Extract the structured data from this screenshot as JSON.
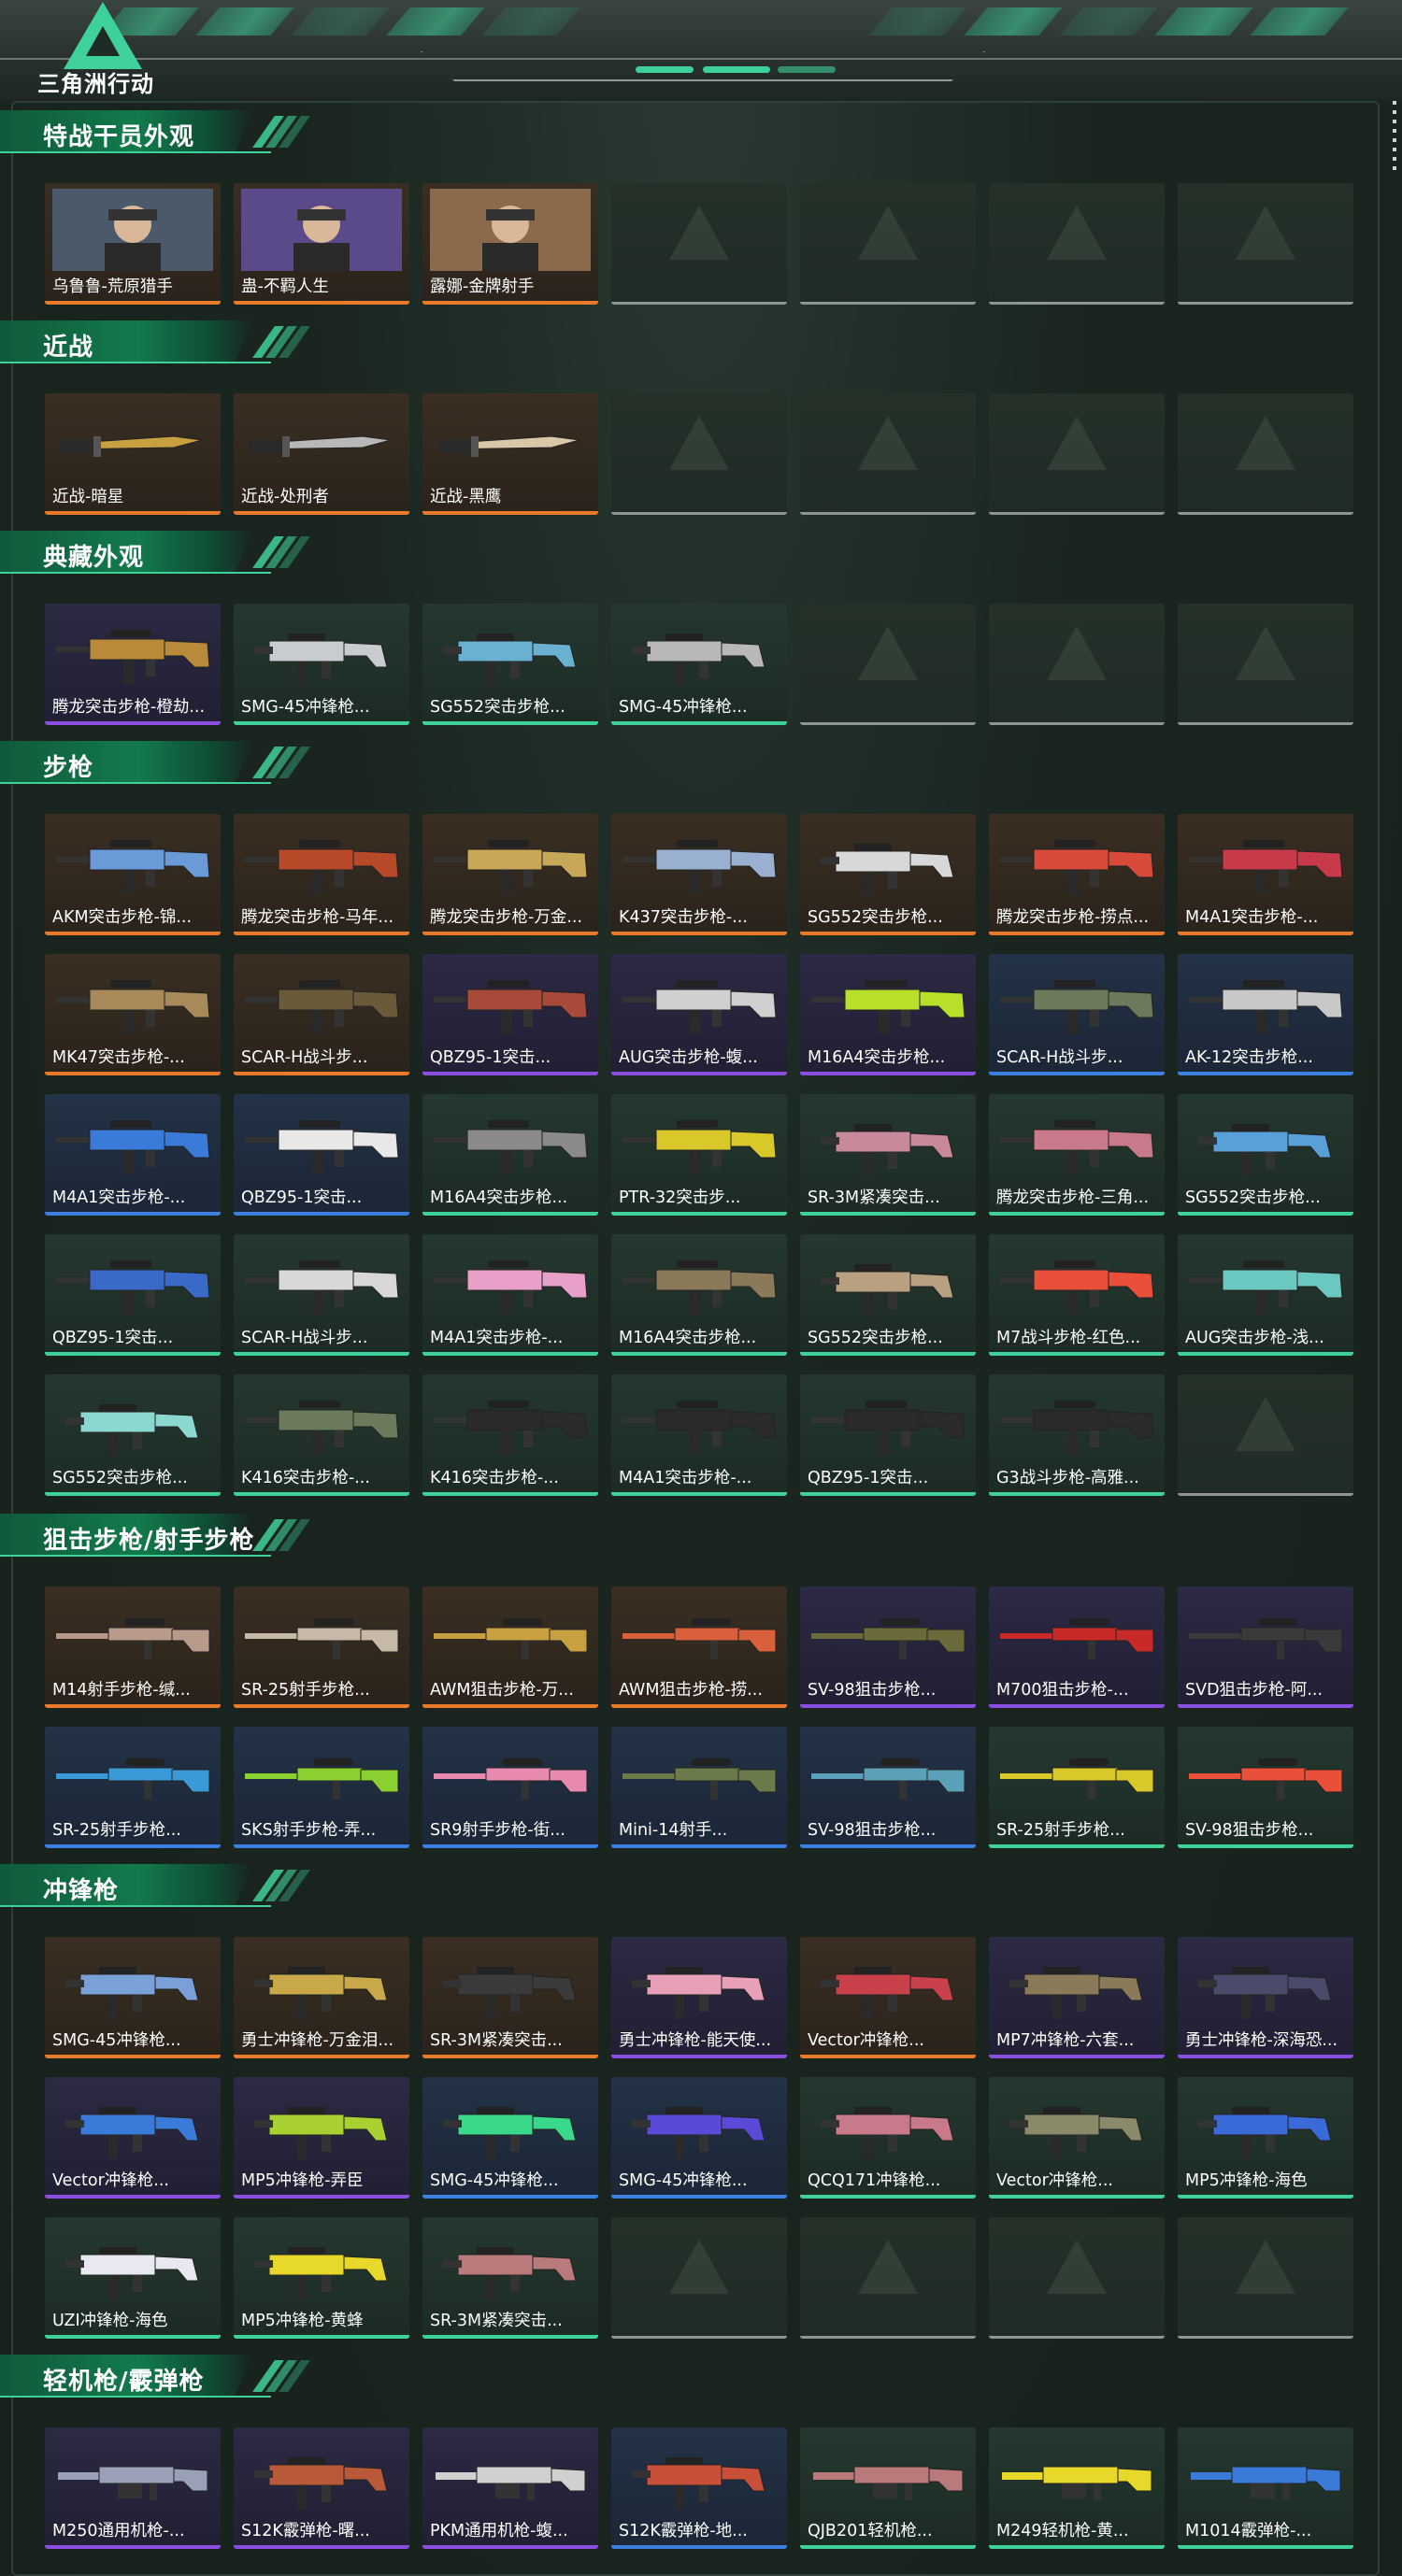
{
  "app": {
    "logo_text": "三角洲行动"
  },
  "sections": [
    {
      "title": "特战干员外观",
      "items": [
        {
          "name": "乌鲁鲁-荒原猎手",
          "rarity": "orange",
          "kind": "operator",
          "color": "#4a5a6a"
        },
        {
          "name": "蛊-不羁人生",
          "rarity": "orange",
          "kind": "operator",
          "color": "#5a4a8a"
        },
        {
          "name": "露娜-金牌射手",
          "rarity": "orange",
          "kind": "operator",
          "color": "#8a6a4a"
        },
        {
          "empty": true
        },
        {
          "empty": true
        },
        {
          "empty": true
        },
        {
          "empty": true
        }
      ]
    },
    {
      "title": "近战",
      "items": [
        {
          "name": "近战-暗星",
          "rarity": "orange",
          "kind": "knife",
          "color": "#c9a040"
        },
        {
          "name": "近战-处刑者",
          "rarity": "orange",
          "kind": "knife",
          "color": "#b8b8b8"
        },
        {
          "name": "近战-黑鹰",
          "rarity": "orange",
          "kind": "knife",
          "color": "#d8c8a8"
        },
        {
          "empty": true
        },
        {
          "empty": true
        },
        {
          "empty": true
        },
        {
          "empty": true
        }
      ]
    },
    {
      "title": "典藏外观",
      "items": [
        {
          "name": "腾龙突击步枪-橙劫...",
          "rarity": "purple",
          "kind": "rifle",
          "color": "#b88a3a"
        },
        {
          "name": "SMG-45冲锋枪...",
          "rarity": "green",
          "kind": "smg",
          "color": "#c8ccd0"
        },
        {
          "name": "SG552突击步枪...",
          "rarity": "green",
          "kind": "smg",
          "color": "#6ab0d0"
        },
        {
          "name": "SMG-45冲锋枪...",
          "rarity": "green",
          "kind": "smg",
          "color": "#b8b8b8"
        },
        {
          "empty": true
        },
        {
          "empty": true
        },
        {
          "empty": true
        }
      ]
    },
    {
      "title": "步枪",
      "items": [
        {
          "name": "AKM突击步枪-锦...",
          "rarity": "orange",
          "kind": "rifle",
          "color": "#6a9ad8"
        },
        {
          "name": "腾龙突击步枪-马年...",
          "rarity": "orange",
          "kind": "rifle",
          "color": "#b84a2a"
        },
        {
          "name": "腾龙突击步枪-万金...",
          "rarity": "orange",
          "kind": "rifle",
          "color": "#c8a858"
        },
        {
          "name": "K437突击步枪-...",
          "rarity": "orange",
          "kind": "rifle",
          "color": "#9ab0d0"
        },
        {
          "name": "SG552突击步枪...",
          "rarity": "orange",
          "kind": "smg",
          "color": "#d8d8d8"
        },
        {
          "name": "腾龙突击步枪-捞点...",
          "rarity": "orange",
          "kind": "rifle",
          "color": "#d84a3a"
        },
        {
          "name": "M4A1突击步枪-...",
          "rarity": "orange",
          "kind": "rifle",
          "color": "#c83a4a"
        },
        {
          "name": "MK47突击步枪-...",
          "rarity": "orange",
          "kind": "rifle",
          "color": "#a88a5a"
        },
        {
          "name": "SCAR-H战斗步...",
          "rarity": "orange",
          "kind": "rifle",
          "color": "#6a5a3a"
        },
        {
          "name": "QBZ95-1突击...",
          "rarity": "purple",
          "kind": "rifle",
          "color": "#a84a3a"
        },
        {
          "name": "AUG突击步枪-蝮...",
          "rarity": "purple",
          "kind": "rifle",
          "color": "#d0d0d0"
        },
        {
          "name": "M16A4突击步枪...",
          "rarity": "purple",
          "kind": "rifle",
          "color": "#b8e02a"
        },
        {
          "name": "SCAR-H战斗步...",
          "rarity": "blue",
          "kind": "rifle",
          "color": "#6a7a5a"
        },
        {
          "name": "AK-12突击步枪...",
          "rarity": "blue",
          "kind": "rifle",
          "color": "#c8c8c8"
        },
        {
          "name": "M4A1突击步枪-...",
          "rarity": "blue",
          "kind": "rifle",
          "color": "#3a7ad8"
        },
        {
          "name": "QBZ95-1突击...",
          "rarity": "blue",
          "kind": "rifle",
          "color": "#e8e8e8"
        },
        {
          "name": "M16A4突击步枪...",
          "rarity": "green",
          "kind": "rifle",
          "color": "#8a8a8a"
        },
        {
          "name": "PTR-32突击步...",
          "rarity": "green",
          "kind": "rifle",
          "color": "#d8c82a"
        },
        {
          "name": "SR-3M紧凑突击...",
          "rarity": "green",
          "kind": "smg",
          "color": "#c88a9a"
        },
        {
          "name": "腾龙突击步枪-三角...",
          "rarity": "green",
          "kind": "rifle",
          "color": "#c87a8a"
        },
        {
          "name": "SG552突击步枪...",
          "rarity": "green",
          "kind": "smg",
          "color": "#5aa0d8"
        },
        {
          "name": "QBZ95-1突击...",
          "rarity": "green",
          "kind": "rifle",
          "color": "#3a6ac8"
        },
        {
          "name": "SCAR-H战斗步...",
          "rarity": "green",
          "kind": "rifle",
          "color": "#d8d8d8"
        },
        {
          "name": "M4A1突击步枪-...",
          "rarity": "green",
          "kind": "rifle",
          "color": "#e8a0c8"
        },
        {
          "name": "M16A4突击步枪...",
          "rarity": "green",
          "kind": "rifle",
          "color": "#8a7a5a"
        },
        {
          "name": "SG552突击步枪...",
          "rarity": "green",
          "kind": "smg",
          "color": "#b8a080"
        },
        {
          "name": "M7战斗步枪-红色...",
          "rarity": "green",
          "kind": "rifle",
          "color": "#e8503a"
        },
        {
          "name": "AUG突击步枪-浅...",
          "rarity": "green",
          "kind": "rifle",
          "color": "#6ac8c0"
        },
        {
          "name": "SG552突击步枪...",
          "rarity": "green",
          "kind": "smg",
          "color": "#8ad8d0"
        },
        {
          "name": "K416突击步枪-...",
          "rarity": "green",
          "kind": "rifle",
          "color": "#6a7a5a"
        },
        {
          "name": "K416突击步枪-...",
          "rarity": "green",
          "kind": "rifle",
          "color": "#2a2a2a"
        },
        {
          "name": "M4A1突击步枪-...",
          "rarity": "green",
          "kind": "rifle",
          "color": "#2a2a2a"
        },
        {
          "name": "QBZ95-1突击...",
          "rarity": "green",
          "kind": "rifle",
          "color": "#2a2a2a"
        },
        {
          "name": "G3战斗步枪-高雅...",
          "rarity": "green",
          "kind": "rifle",
          "color": "#2a2a2a"
        },
        {
          "empty": true
        }
      ]
    },
    {
      "title": "狙击步枪/射手步枪",
      "items": [
        {
          "name": "M14射手步枪-缄...",
          "rarity": "orange",
          "kind": "sniper",
          "color": "#b89a8a"
        },
        {
          "name": "SR-25射手步枪...",
          "rarity": "orange",
          "kind": "sniper",
          "color": "#c8b8a8"
        },
        {
          "name": "AWM狙击步枪-万...",
          "rarity": "orange",
          "kind": "sniper",
          "color": "#c8a040"
        },
        {
          "name": "AWM狙击步枪-捞...",
          "rarity": "orange",
          "kind": "sniper",
          "color": "#d8603a"
        },
        {
          "name": "SV-98狙击步枪...",
          "rarity": "purple",
          "kind": "sniper",
          "color": "#6a6a3a"
        },
        {
          "name": "M700狙击步枪-...",
          "rarity": "purple",
          "kind": "sniper",
          "color": "#c82a2a"
        },
        {
          "name": "SVD狙击步枪-阿...",
          "rarity": "purple",
          "kind": "sniper",
          "color": "#3a3a3a"
        },
        {
          "name": "SR-25射手步枪...",
          "rarity": "blue",
          "kind": "sniper",
          "color": "#3a9ad8"
        },
        {
          "name": "SKS射手步枪-弄...",
          "rarity": "blue",
          "kind": "sniper",
          "color": "#8ad030"
        },
        {
          "name": "SR9射手步枪-街...",
          "rarity": "blue",
          "kind": "sniper",
          "color": "#e88ab0"
        },
        {
          "name": "Mini-14射手...",
          "rarity": "blue",
          "kind": "sniper",
          "color": "#6a7a4a"
        },
        {
          "name": "SV-98狙击步枪...",
          "rarity": "blue",
          "kind": "sniper",
          "color": "#5aa0b8"
        },
        {
          "name": "SR-25射手步枪...",
          "rarity": "green",
          "kind": "sniper",
          "color": "#d8c82a"
        },
        {
          "name": "SV-98狙击步枪...",
          "rarity": "green",
          "kind": "sniper",
          "color": "#e8503a"
        }
      ]
    },
    {
      "title": "冲锋枪",
      "items": [
        {
          "name": "SMG-45冲锋枪...",
          "rarity": "orange",
          "kind": "smg",
          "color": "#7aa0d8"
        },
        {
          "name": "勇士冲锋枪-万金泪...",
          "rarity": "orange",
          "kind": "smg",
          "color": "#c8a848"
        },
        {
          "name": "SR-3M紧凑突击...",
          "rarity": "orange",
          "kind": "smg",
          "color": "#3a3a3a"
        },
        {
          "name": "勇士冲锋枪-能天使...",
          "rarity": "purple",
          "kind": "smg",
          "color": "#e8a0b8"
        },
        {
          "name": "Vector冲锋枪...",
          "rarity": "orange",
          "kind": "smg",
          "color": "#c8404a"
        },
        {
          "name": "MP7冲锋枪-六套...",
          "rarity": "purple",
          "kind": "smg",
          "color": "#8a7a5a"
        },
        {
          "name": "勇士冲锋枪-深海恐...",
          "rarity": "purple",
          "kind": "smg",
          "color": "#4a4a6a"
        },
        {
          "name": "Vector冲锋枪...",
          "rarity": "purple",
          "kind": "smg",
          "color": "#3a7ad8"
        },
        {
          "name": "MP5冲锋枪-弄臣",
          "rarity": "purple",
          "kind": "smg",
          "color": "#a8d030"
        },
        {
          "name": "SMG-45冲锋枪...",
          "rarity": "blue",
          "kind": "smg",
          "color": "#3ad88a"
        },
        {
          "name": "SMG-45冲锋枪...",
          "rarity": "blue",
          "kind": "smg",
          "color": "#5a4ad8"
        },
        {
          "name": "QCQ171冲锋枪...",
          "rarity": "green",
          "kind": "smg",
          "color": "#c87a8a"
        },
        {
          "name": "Vector冲锋枪...",
          "rarity": "green",
          "kind": "smg",
          "color": "#8a8a6a"
        },
        {
          "name": "MP5冲锋枪-海色",
          "rarity": "green",
          "kind": "smg",
          "color": "#3a6ad8"
        },
        {
          "name": "UZI冲锋枪-海色",
          "rarity": "green",
          "kind": "smg",
          "color": "#e8e8f0"
        },
        {
          "name": "MP5冲锋枪-黄蜂",
          "rarity": "green",
          "kind": "smg",
          "color": "#e8d82a"
        },
        {
          "name": "SR-3M紧凑突击...",
          "rarity": "green",
          "kind": "smg",
          "color": "#b87a7a"
        },
        {
          "empty": true
        },
        {
          "empty": true
        },
        {
          "empty": true
        },
        {
          "empty": true
        }
      ]
    },
    {
      "title": "轻机枪/霰弹枪",
      "items": [
        {
          "name": "M250通用机枪-...",
          "rarity": "purple",
          "kind": "lmg",
          "color": "#9aa0b8"
        },
        {
          "name": "S12K霰弹枪-曙...",
          "rarity": "purple",
          "kind": "smg",
          "color": "#b85a3a"
        },
        {
          "name": "PKM通用机枪-蝮...",
          "rarity": "purple",
          "kind": "lmg",
          "color": "#d0d0d0"
        },
        {
          "name": "S12K霰弹枪-地...",
          "rarity": "blue",
          "kind": "smg",
          "color": "#c8503a"
        },
        {
          "name": "QJB201轻机枪...",
          "rarity": "green",
          "kind": "lmg",
          "color": "#b87a7a"
        },
        {
          "name": "M249轻机枪-黄...",
          "rarity": "green",
          "kind": "lmg",
          "color": "#e8d82a"
        },
        {
          "name": "M1014霰弹枪-...",
          "rarity": "green",
          "kind": "lmg",
          "color": "#3a7ad8"
        }
      ]
    }
  ]
}
